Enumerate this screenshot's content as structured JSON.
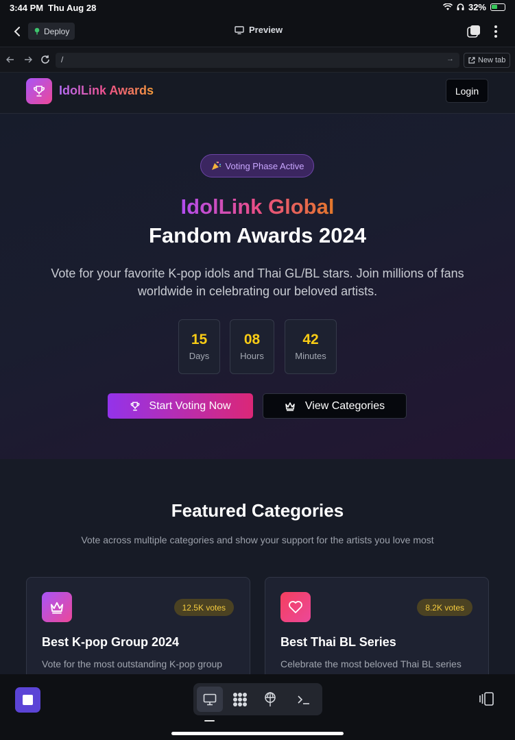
{
  "status_bar": {
    "time": "3:44 PM",
    "date": "Thu Aug 28",
    "battery": "32%"
  },
  "app_bar": {
    "deploy_label": "Deploy",
    "preview_label": "Preview"
  },
  "url_bar": {
    "url": "/",
    "new_tab_label": "New tab"
  },
  "site": {
    "brand": "IdolLink Awards",
    "login_label": "Login"
  },
  "hero": {
    "badge": "Voting Phase Active",
    "title_gradient": "IdolLink Global",
    "title_plain": "Fandom Awards 2024",
    "description": "Vote for your favorite K-pop idols and Thai GL/BL stars. Join millions of fans worldwide in celebrating our beloved artists.",
    "countdown": [
      {
        "value": "15",
        "unit": "Days"
      },
      {
        "value": "08",
        "unit": "Hours"
      },
      {
        "value": "42",
        "unit": "Minutes"
      }
    ],
    "start_voting_label": "Start Voting Now",
    "view_categories_label": "View Categories"
  },
  "featured": {
    "title": "Featured Categories",
    "subtitle": "Vote across multiple categories and show your support for the artists you love most",
    "cards": [
      {
        "icon": "crown-icon",
        "votes": "12.5K votes",
        "title": "Best K-pop Group 2024",
        "description": "Vote for the most outstanding K-pop group"
      },
      {
        "icon": "heart-icon",
        "votes": "8.2K votes",
        "title": "Best Thai BL Series",
        "description": "Celebrate the most beloved Thai BL series"
      }
    ]
  },
  "colors": {
    "accent_purple": "#9333ea",
    "accent_pink": "#db2777",
    "countdown_yellow": "#facc15",
    "stop_button": "#5b44d6"
  }
}
